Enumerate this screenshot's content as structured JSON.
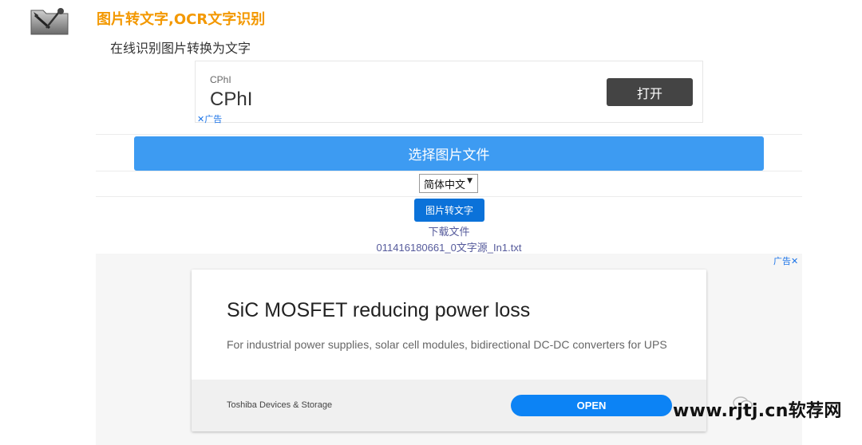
{
  "header": {
    "title": "图片转文字,OCR文字识别",
    "subtitle": "在线识别图片转换为文字"
  },
  "ad_top": {
    "small_label": "CPhI",
    "big_label": "CPhI",
    "open_label": "打开",
    "close_label": "✕广告"
  },
  "main": {
    "select_file_label": "选择图片文件",
    "language_value": "简体中文",
    "convert_label": "图片转文字",
    "download_label": "下载文件",
    "download_filename": "011416180661_0文字源_In1.txt"
  },
  "ad_bottom": {
    "tag": "广告✕",
    "headline": "SiC MOSFET reducing power loss",
    "description": "For industrial power supplies, solar cell modules, bidirectional DC-DC converters for UPS",
    "advertiser": "Toshiba Devices & Storage",
    "open_label": "OPEN"
  },
  "watermark": {
    "text": "www.rjtj.cn软荐网"
  },
  "colors": {
    "title_orange": "#f39800",
    "select_button": "#3d9bf2",
    "convert_button": "#0b72d9",
    "open_button": "#0c83f5"
  }
}
